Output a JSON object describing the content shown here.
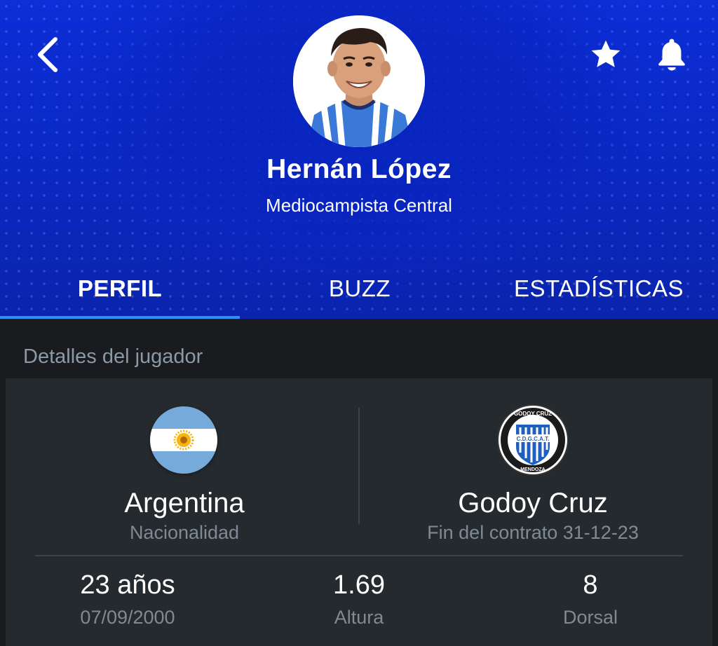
{
  "header": {
    "player_name": "Hernán López",
    "player_position": "Mediocampista Central",
    "back_icon": "chevron-left-icon",
    "favorite_icon": "star-icon",
    "notify_icon": "bell-icon"
  },
  "tabs": [
    {
      "label": "PERFIL",
      "active": true
    },
    {
      "label": "BUZZ",
      "active": false
    },
    {
      "label": "ESTADÍSTICAS",
      "active": false
    }
  ],
  "details": {
    "section_title": "Detalles del jugador",
    "nationality": {
      "value": "Argentina",
      "label": "Nacionalidad"
    },
    "club": {
      "value": "Godoy Cruz",
      "label": "Fin del contrato 31-12-23",
      "crest_top": "GODOY CRUZ",
      "crest_mid": "C.D.G.C.A.T.",
      "crest_bottom": "MENDOZA"
    },
    "stats": [
      {
        "value": "23 años",
        "label": "07/09/2000"
      },
      {
        "value": "1.69",
        "label": "Altura"
      },
      {
        "value": "8",
        "label": "Dorsal"
      }
    ]
  },
  "colors": {
    "header_blue": "#0a29c6",
    "tab_indicator": "#2f8ff0",
    "background": "#191b1f",
    "card": "#252a2f"
  }
}
